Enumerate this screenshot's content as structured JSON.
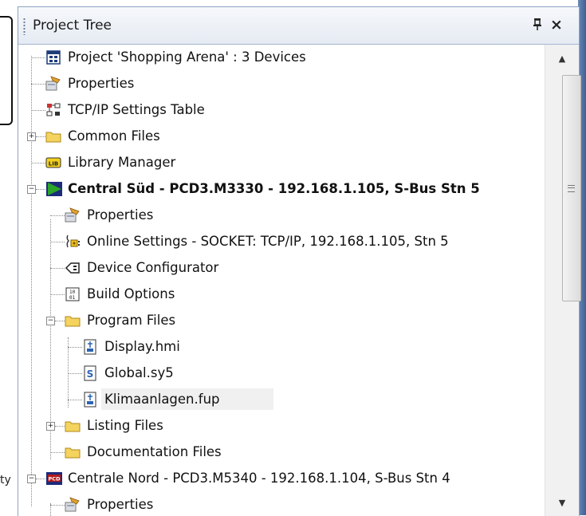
{
  "panel": {
    "title": "Project Tree",
    "pin_glyph": "ꟼ",
    "close_glyph": "×"
  },
  "background": {
    "left_text_fragment": "ty"
  },
  "tree": {
    "items": [
      {
        "label": "Project 'Shopping Arena' : 3 Devices",
        "icon": "project-icon"
      },
      {
        "label": "Properties",
        "icon": "properties-icon"
      },
      {
        "label": "TCP/IP Settings Table",
        "icon": "network-table-icon"
      },
      {
        "label": "Common Files",
        "icon": "folder-icon",
        "expandable": true,
        "expanded": false
      },
      {
        "label": "Library Manager",
        "icon": "library-icon"
      },
      {
        "label": "Central Süd - PCD3.M3330 - 192.168.1.105, S-Bus Stn 5",
        "icon": "device-active-icon",
        "expandable": true,
        "expanded": true,
        "bold": true
      },
      {
        "label": "Properties",
        "icon": "properties-icon"
      },
      {
        "label": "Online Settings - SOCKET: TCP/IP, 192.168.1.105, Stn 5",
        "icon": "online-settings-icon"
      },
      {
        "label": "Device Configurator",
        "icon": "device-configurator-icon"
      },
      {
        "label": "Build Options",
        "icon": "build-options-icon"
      },
      {
        "label": "Program Files",
        "icon": "folder-open-icon",
        "expandable": true,
        "expanded": true
      },
      {
        "label": "Display.hmi",
        "icon": "file-icon"
      },
      {
        "label": "Global.sy5",
        "icon": "symbol-file-icon"
      },
      {
        "label": "Klimaanlagen.fup",
        "icon": "file-icon",
        "selected": true
      },
      {
        "label": "Listing Files",
        "icon": "folder-icon",
        "expandable": true,
        "expanded": false
      },
      {
        "label": "Documentation Files",
        "icon": "folder-icon"
      },
      {
        "label": "Centrale Nord - PCD3.M5340 - 192.168.1.104, S-Bus Stn 4",
        "icon": "device-pcd-icon",
        "expandable": true,
        "expanded": true
      },
      {
        "label": "Properties",
        "icon": "properties-icon"
      }
    ]
  },
  "scrollbar": {
    "up_glyph": "▲",
    "down_glyph": "▼",
    "thumb_fraction": 0.5
  },
  "colors": {
    "folder": "#f4d35e",
    "device_active": "#2aa52a",
    "pcd_badge": "#b31b1b",
    "accent": "#3a67b0"
  }
}
